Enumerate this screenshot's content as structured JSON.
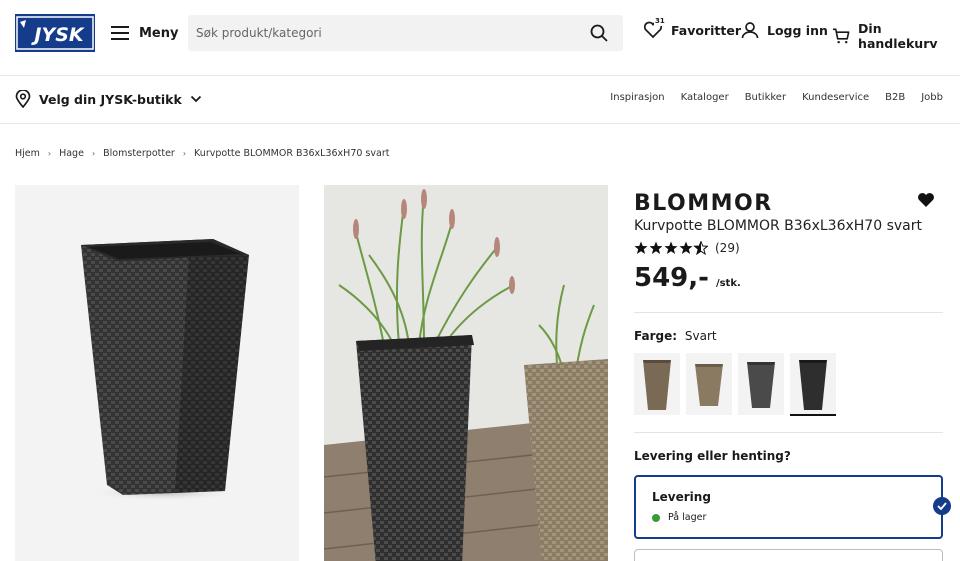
{
  "header": {
    "logo_text": "JYSK",
    "menu_label": "Meny",
    "search_placeholder": "Søk produkt/kategori",
    "favorites_label": "Favoritter",
    "favorites_count": "31",
    "login_label": "Logg inn",
    "cart_label": "Din handlekurv"
  },
  "subheader": {
    "store_label": "Velg din JYSK-butikk",
    "nav": [
      "Inspirasjon",
      "Kataloger",
      "Butikker",
      "Kundeservice",
      "B2B",
      "Jobb"
    ]
  },
  "breadcrumb": [
    "Hjem",
    "Hage",
    "Blomsterpotter",
    "Kurvpotte BLOMMOR B36xL36xH70 svart"
  ],
  "product": {
    "brand": "BLOMMOR",
    "name": "Kurvpotte BLOMMOR B36xL36xH70 svart",
    "rating": 4.5,
    "rating_count": "(29)",
    "price": "549,-",
    "price_unit": "/stk.",
    "color_label": "Farge:",
    "color_value": "Svart",
    "swatches": [
      {
        "name": "brun-høy",
        "color": "#7a6a55"
      },
      {
        "name": "brun-lav",
        "color": "#8a7a62"
      },
      {
        "name": "grå",
        "color": "#4a4a4a"
      },
      {
        "name": "svart",
        "color": "#2e2e2e",
        "selected": true
      }
    ]
  },
  "delivery": {
    "question": "Levering eller henting?",
    "option_title": "Levering",
    "option_status": "På lager"
  },
  "colors": {
    "brand_blue": "#143c8a",
    "stock_green": "#3a9a3a"
  }
}
